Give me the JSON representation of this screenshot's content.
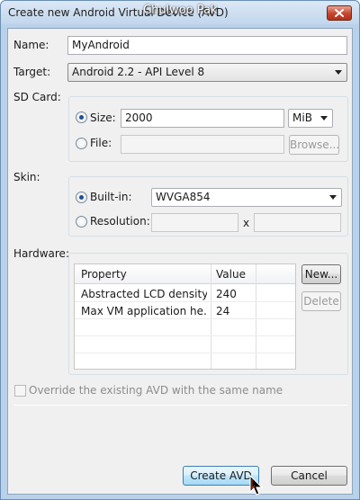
{
  "window": {
    "title": "Create new Android Virtual Device (AVD)",
    "watermark": "Chulwoo Pak"
  },
  "form": {
    "name_label": "Name:",
    "name_value": "MyAndroid",
    "target_label": "Target:",
    "target_value": "Android 2.2 - API Level 8",
    "sdcard_label": "SD Card:",
    "size_label": "Size:",
    "size_value": "2000",
    "size_unit": "MiB",
    "file_label": "File:",
    "browse_label": "Browse...",
    "skin_label": "Skin:",
    "builtin_label": "Built-in:",
    "builtin_value": "WVGA854",
    "resolution_label": "Resolution:",
    "resolution_x": "x",
    "hardware_label": "Hardware:"
  },
  "hardware": {
    "columns": [
      "Property",
      "Value"
    ],
    "rows": [
      {
        "property": "Abstracted LCD density",
        "value": "240"
      },
      {
        "property": "Max VM application he...",
        "value": "24"
      }
    ],
    "new_label": "New...",
    "delete_label": "Delete"
  },
  "override_label": "Override the existing AVD with the same name",
  "footer": {
    "create_label": "Create AVD",
    "cancel_label": "Cancel"
  }
}
